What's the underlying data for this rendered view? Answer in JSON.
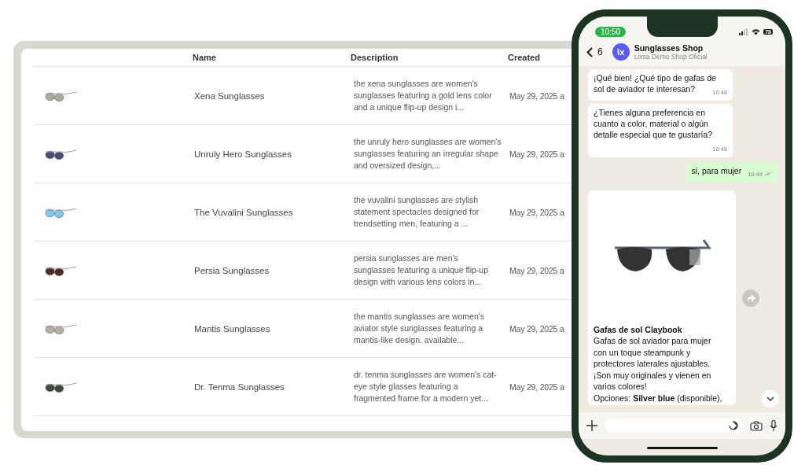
{
  "table": {
    "columns": [
      "Name",
      "Description",
      "Created"
    ],
    "rows": [
      {
        "name": "Xena Sunglasses",
        "description": "the xena sunglasses are women's sunglasses featuring a gold lens color and a unique flip-up design i...",
        "created": "May 29, 2025 a",
        "color": "#a9ad9c"
      },
      {
        "name": "Unruly Hero Sunglasses",
        "description": "the unruly hero sunglasses are women's sunglasses featuring an irregular shape and oversized design,...",
        "created": "May 29, 2025 a",
        "color": "#4a4a78"
      },
      {
        "name": "The Vuvalini Sunglasses",
        "description": "the vuvalini sunglasses are stylish statement spectacles designed for trendsetting men, featuring a ...",
        "created": "May 29, 2025 a",
        "color": "#7cc8f0"
      },
      {
        "name": "Persia Sunglasses",
        "description": "persia sunglasses are men's sunglasses featuring a unique flip-up design with various lens colors in...",
        "created": "May 29, 2025 a",
        "color": "#4a2a22"
      },
      {
        "name": "Mantis Sunglasses",
        "description": "the mantis sunglasses are women's aviator style sunglasses featuring a mantis-like design. available...",
        "created": "May 29, 2025 a",
        "color": "#b8ada0"
      },
      {
        "name": "Dr. Tenma Sunglasses",
        "description": "dr. tenma sunglasses are women's cat-eye style glasses featuring a fragmented frame for a modern yet...",
        "created": "May 29, 2025 a",
        "color": "#3e4a3e"
      }
    ]
  },
  "phone": {
    "time": "10:50",
    "battery": "78",
    "header": {
      "back_count": "6",
      "avatar": "lx",
      "title": "Sunglasses Shop",
      "subtitle": "Lixsa Demo Shop Oficial"
    },
    "messages": [
      {
        "kind": "in",
        "text": "¡Qué bien! ¿Qué tipo de gafas de sol de aviador te interesan?",
        "time": "10:48"
      },
      {
        "kind": "in",
        "text": "¿Tienes alguna preferencia en cuanto a color, material o algún detalle especial que te gustaría?",
        "time": "10:48"
      },
      {
        "kind": "out",
        "text": "si, para mujer",
        "time": "10:49"
      },
      {
        "kind": "product",
        "title": "Gafas de sol Claybook",
        "text": "Gafas de sol aviador para mujer con un toque steampunk y protectores laterales ajustables. ¡Son muy originales y vienen en varios colores!",
        "options": "Opciones: **Silver blue** (disponible),"
      }
    ]
  }
}
